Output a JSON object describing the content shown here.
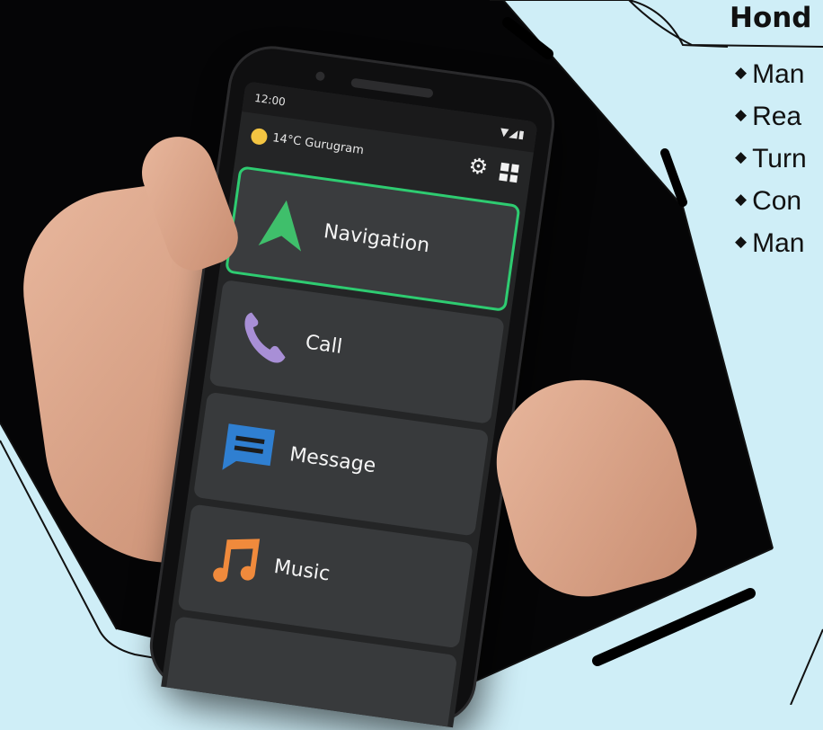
{
  "side_panel": {
    "title": "Hond",
    "features": [
      "Man",
      "Rea",
      "Turn",
      "Con",
      "Man"
    ]
  },
  "phone": {
    "status_time": "12:00",
    "status_icons": "▼◢▮",
    "weather": "14°C Gurugram",
    "tiles": [
      {
        "label": "Navigation",
        "icon": "navigation-arrow-icon",
        "selected": true
      },
      {
        "label": "Call",
        "icon": "phone-icon",
        "selected": false
      },
      {
        "label": "Message",
        "icon": "message-icon",
        "selected": false
      },
      {
        "label": "Music",
        "icon": "music-note-icon",
        "selected": false
      }
    ]
  },
  "colors": {
    "background": "#cfeef7",
    "photo_background": "#000000",
    "selected_border": "#2ecc71",
    "navigation_icon": "#3fbf6b",
    "call_icon": "#a88fd6",
    "message_icon": "#2f7fd1",
    "music_icon": "#f08a3c",
    "sun": "#f4c542"
  }
}
